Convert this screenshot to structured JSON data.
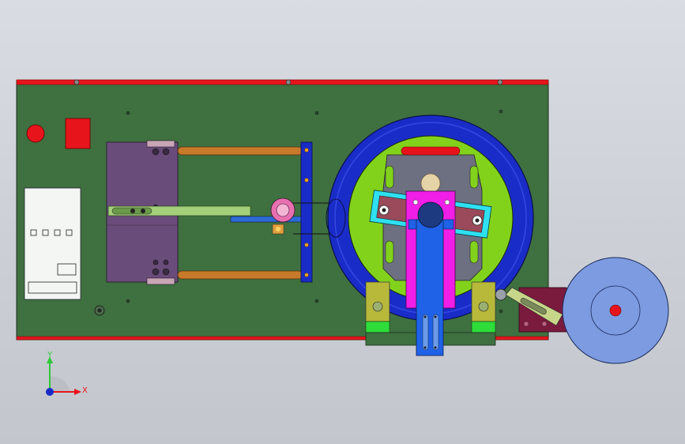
{
  "view": {
    "background_top": "#d9dde3",
    "background_bottom": "#c3c7cd"
  },
  "colors": {
    "base_plate": "#3f7040",
    "rail_red": "#e8141c",
    "panel_purple": "#6a4c7a",
    "rod_orange": "#c87a2a",
    "blue_ring": "#1a2cc8",
    "green_disc": "#82d21c",
    "magenta_slider": "#f01ee6",
    "blue_arm": "#1f62e8",
    "cyan_link": "#2ee0f0",
    "motor_disc": "#7d9be0",
    "maroon_bracket": "#7a1a3c",
    "yellow_block": "#b8b83a",
    "green_block": "#2edc3a"
  },
  "icons": {
    "triad": "coordinate-triad-icon",
    "emergency_stop": "red-round-button-icon",
    "indicator": "red-square-indicator-icon"
  },
  "triad": {
    "y_label": "Y",
    "x_label": "X",
    "y_color": "#2ec83a",
    "x_color": "#e8141c",
    "z_color": "#1a2cc8"
  }
}
